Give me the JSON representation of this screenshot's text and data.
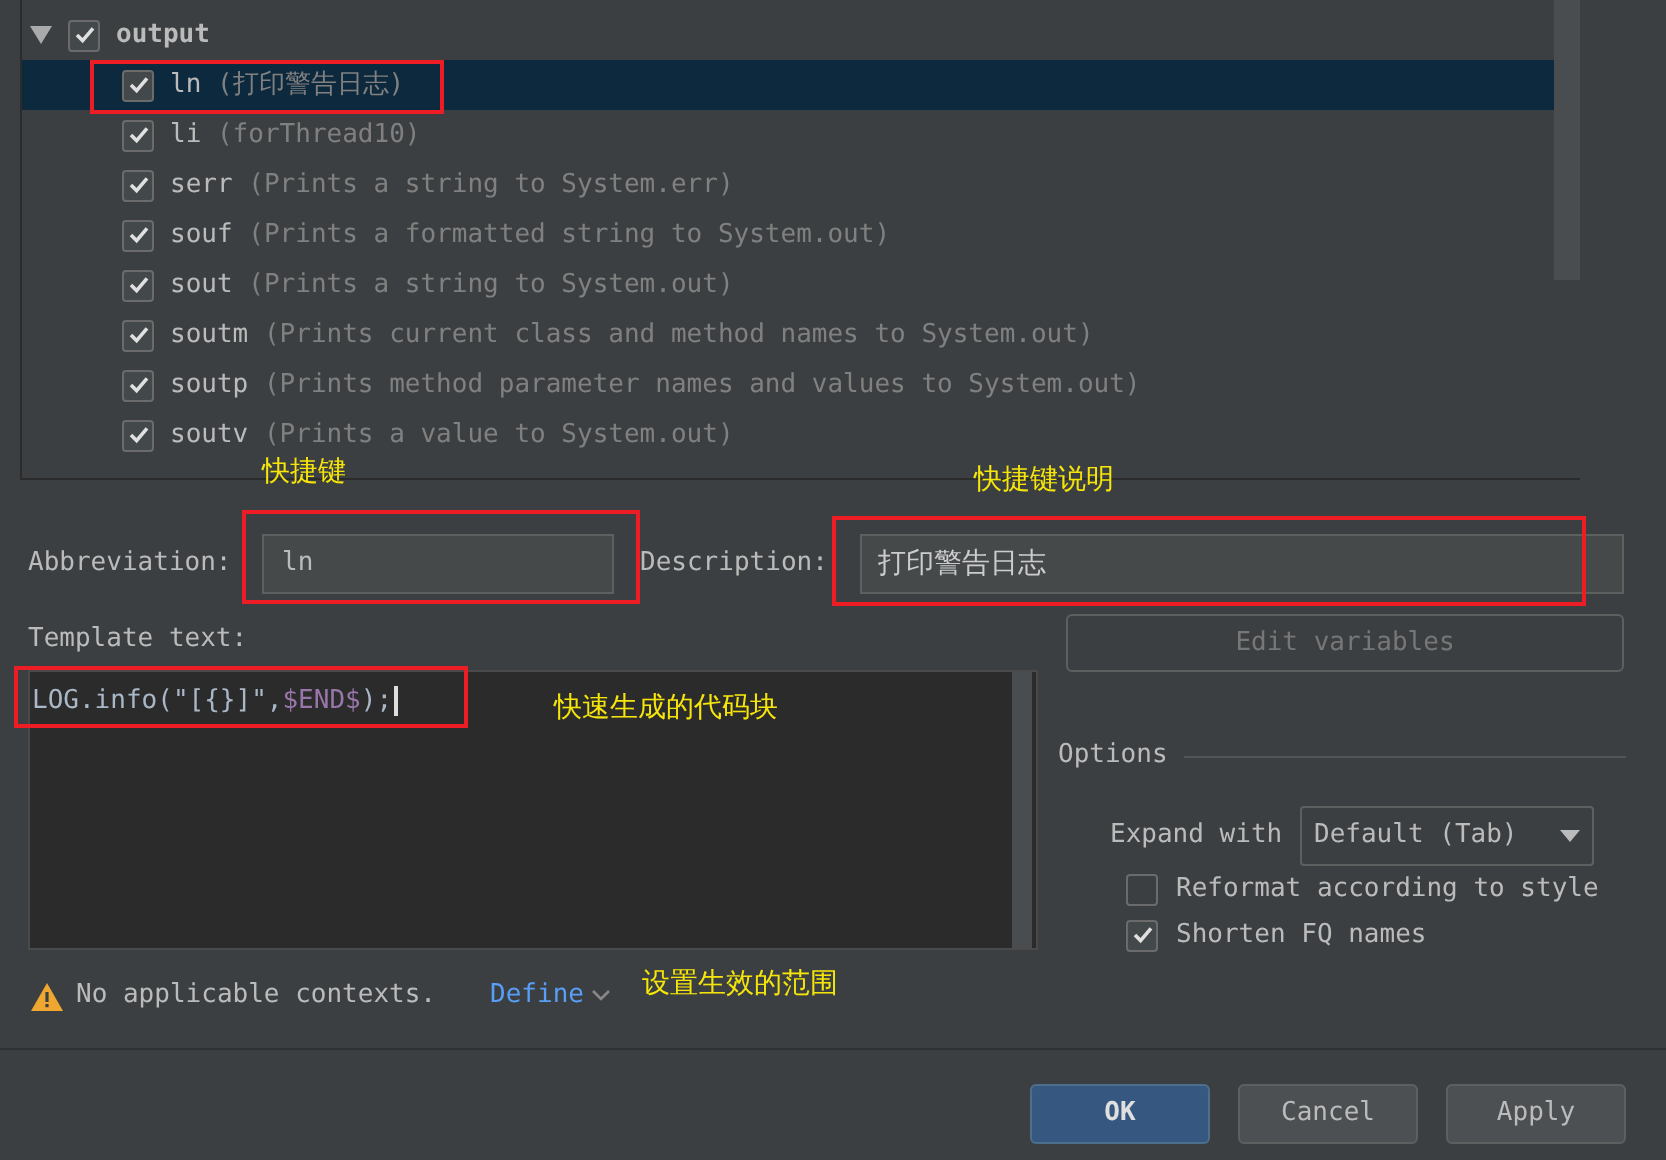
{
  "tree": {
    "group": {
      "name": "output",
      "checked": true,
      "expanded": true,
      "children": [
        {
          "name": "ln",
          "description": "(打印警告日志)",
          "checked": true,
          "selected": true
        },
        {
          "name": "li",
          "description": "(forThread10)",
          "checked": true,
          "selected": false
        },
        {
          "name": "serr",
          "description": "(Prints a string to System.err)",
          "checked": true,
          "selected": false
        },
        {
          "name": "souf",
          "description": "(Prints a formatted string to System.out)",
          "checked": true,
          "selected": false
        },
        {
          "name": "sout",
          "description": "(Prints a string to System.out)",
          "checked": true,
          "selected": false
        },
        {
          "name": "soutm",
          "description": "(Prints current class and method names to System.out)",
          "checked": true,
          "selected": false
        },
        {
          "name": "soutp",
          "description": "(Prints method parameter names and values to System.out)",
          "checked": true,
          "selected": false
        },
        {
          "name": "soutv",
          "description": "(Prints a value to System.out)",
          "checked": true,
          "selected": false
        }
      ]
    }
  },
  "abbreviation": {
    "label": "Abbreviation:",
    "value": "ln"
  },
  "description": {
    "label": "Description:",
    "value": "打印警告日志"
  },
  "template": {
    "label": "Template text:",
    "parts": [
      {
        "text": "LOG.info(\"[{}]\",",
        "kind": "plain"
      },
      {
        "text": "$END$",
        "kind": "variable"
      },
      {
        "text": ");",
        "kind": "plain"
      }
    ]
  },
  "edit_variables": {
    "label": "Edit variables",
    "disabled": true
  },
  "options": {
    "title": "Options",
    "expand_label": "Expand with",
    "expand_value": "Default (Tab)",
    "checkboxes": [
      {
        "label": "Reformat according to style",
        "checked": false
      },
      {
        "label": "Shorten FQ names",
        "checked": true
      }
    ]
  },
  "warning": {
    "text": "No applicable contexts.",
    "link": "Define"
  },
  "buttons": [
    {
      "label": "OK",
      "kind": "primary"
    },
    {
      "label": "Cancel",
      "kind": "normal"
    },
    {
      "label": "Apply",
      "kind": "normal"
    }
  ],
  "annotations": [
    {
      "text": "快捷键"
    },
    {
      "text": "快捷键说明"
    },
    {
      "text": "快速生成的代码块"
    },
    {
      "text": "设置生效的范围"
    }
  ]
}
